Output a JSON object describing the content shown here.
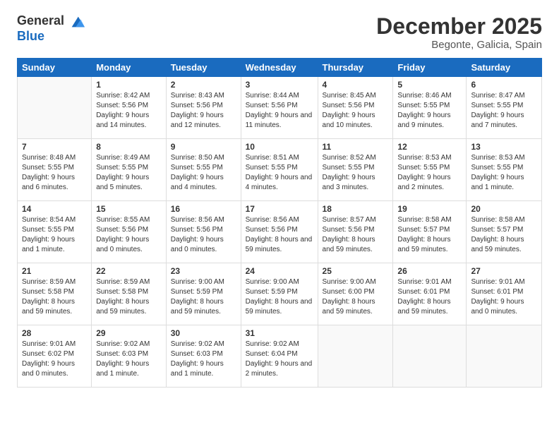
{
  "logo": {
    "general": "General",
    "blue": "Blue"
  },
  "title": "December 2025",
  "location": "Begonte, Galicia, Spain",
  "days_of_week": [
    "Sunday",
    "Monday",
    "Tuesday",
    "Wednesday",
    "Thursday",
    "Friday",
    "Saturday"
  ],
  "weeks": [
    [
      {
        "day": "",
        "sunrise": "",
        "sunset": "",
        "daylight": ""
      },
      {
        "day": "1",
        "sunrise": "Sunrise: 8:42 AM",
        "sunset": "Sunset: 5:56 PM",
        "daylight": "Daylight: 9 hours and 14 minutes."
      },
      {
        "day": "2",
        "sunrise": "Sunrise: 8:43 AM",
        "sunset": "Sunset: 5:56 PM",
        "daylight": "Daylight: 9 hours and 12 minutes."
      },
      {
        "day": "3",
        "sunrise": "Sunrise: 8:44 AM",
        "sunset": "Sunset: 5:56 PM",
        "daylight": "Daylight: 9 hours and 11 minutes."
      },
      {
        "day": "4",
        "sunrise": "Sunrise: 8:45 AM",
        "sunset": "Sunset: 5:56 PM",
        "daylight": "Daylight: 9 hours and 10 minutes."
      },
      {
        "day": "5",
        "sunrise": "Sunrise: 8:46 AM",
        "sunset": "Sunset: 5:55 PM",
        "daylight": "Daylight: 9 hours and 9 minutes."
      },
      {
        "day": "6",
        "sunrise": "Sunrise: 8:47 AM",
        "sunset": "Sunset: 5:55 PM",
        "daylight": "Daylight: 9 hours and 7 minutes."
      }
    ],
    [
      {
        "day": "7",
        "sunrise": "Sunrise: 8:48 AM",
        "sunset": "Sunset: 5:55 PM",
        "daylight": "Daylight: 9 hours and 6 minutes."
      },
      {
        "day": "8",
        "sunrise": "Sunrise: 8:49 AM",
        "sunset": "Sunset: 5:55 PM",
        "daylight": "Daylight: 9 hours and 5 minutes."
      },
      {
        "day": "9",
        "sunrise": "Sunrise: 8:50 AM",
        "sunset": "Sunset: 5:55 PM",
        "daylight": "Daylight: 9 hours and 4 minutes."
      },
      {
        "day": "10",
        "sunrise": "Sunrise: 8:51 AM",
        "sunset": "Sunset: 5:55 PM",
        "daylight": "Daylight: 9 hours and 4 minutes."
      },
      {
        "day": "11",
        "sunrise": "Sunrise: 8:52 AM",
        "sunset": "Sunset: 5:55 PM",
        "daylight": "Daylight: 9 hours and 3 minutes."
      },
      {
        "day": "12",
        "sunrise": "Sunrise: 8:53 AM",
        "sunset": "Sunset: 5:55 PM",
        "daylight": "Daylight: 9 hours and 2 minutes."
      },
      {
        "day": "13",
        "sunrise": "Sunrise: 8:53 AM",
        "sunset": "Sunset: 5:55 PM",
        "daylight": "Daylight: 9 hours and 1 minute."
      }
    ],
    [
      {
        "day": "14",
        "sunrise": "Sunrise: 8:54 AM",
        "sunset": "Sunset: 5:55 PM",
        "daylight": "Daylight: 9 hours and 1 minute."
      },
      {
        "day": "15",
        "sunrise": "Sunrise: 8:55 AM",
        "sunset": "Sunset: 5:56 PM",
        "daylight": "Daylight: 9 hours and 0 minutes."
      },
      {
        "day": "16",
        "sunrise": "Sunrise: 8:56 AM",
        "sunset": "Sunset: 5:56 PM",
        "daylight": "Daylight: 9 hours and 0 minutes."
      },
      {
        "day": "17",
        "sunrise": "Sunrise: 8:56 AM",
        "sunset": "Sunset: 5:56 PM",
        "daylight": "Daylight: 8 hours and 59 minutes."
      },
      {
        "day": "18",
        "sunrise": "Sunrise: 8:57 AM",
        "sunset": "Sunset: 5:56 PM",
        "daylight": "Daylight: 8 hours and 59 minutes."
      },
      {
        "day": "19",
        "sunrise": "Sunrise: 8:58 AM",
        "sunset": "Sunset: 5:57 PM",
        "daylight": "Daylight: 8 hours and 59 minutes."
      },
      {
        "day": "20",
        "sunrise": "Sunrise: 8:58 AM",
        "sunset": "Sunset: 5:57 PM",
        "daylight": "Daylight: 8 hours and 59 minutes."
      }
    ],
    [
      {
        "day": "21",
        "sunrise": "Sunrise: 8:59 AM",
        "sunset": "Sunset: 5:58 PM",
        "daylight": "Daylight: 8 hours and 59 minutes."
      },
      {
        "day": "22",
        "sunrise": "Sunrise: 8:59 AM",
        "sunset": "Sunset: 5:58 PM",
        "daylight": "Daylight: 8 hours and 59 minutes."
      },
      {
        "day": "23",
        "sunrise": "Sunrise: 9:00 AM",
        "sunset": "Sunset: 5:59 PM",
        "daylight": "Daylight: 8 hours and 59 minutes."
      },
      {
        "day": "24",
        "sunrise": "Sunrise: 9:00 AM",
        "sunset": "Sunset: 5:59 PM",
        "daylight": "Daylight: 8 hours and 59 minutes."
      },
      {
        "day": "25",
        "sunrise": "Sunrise: 9:00 AM",
        "sunset": "Sunset: 6:00 PM",
        "daylight": "Daylight: 8 hours and 59 minutes."
      },
      {
        "day": "26",
        "sunrise": "Sunrise: 9:01 AM",
        "sunset": "Sunset: 6:01 PM",
        "daylight": "Daylight: 8 hours and 59 minutes."
      },
      {
        "day": "27",
        "sunrise": "Sunrise: 9:01 AM",
        "sunset": "Sunset: 6:01 PM",
        "daylight": "Daylight: 9 hours and 0 minutes."
      }
    ],
    [
      {
        "day": "28",
        "sunrise": "Sunrise: 9:01 AM",
        "sunset": "Sunset: 6:02 PM",
        "daylight": "Daylight: 9 hours and 0 minutes."
      },
      {
        "day": "29",
        "sunrise": "Sunrise: 9:02 AM",
        "sunset": "Sunset: 6:03 PM",
        "daylight": "Daylight: 9 hours and 1 minute."
      },
      {
        "day": "30",
        "sunrise": "Sunrise: 9:02 AM",
        "sunset": "Sunset: 6:03 PM",
        "daylight": "Daylight: 9 hours and 1 minute."
      },
      {
        "day": "31",
        "sunrise": "Sunrise: 9:02 AM",
        "sunset": "Sunset: 6:04 PM",
        "daylight": "Daylight: 9 hours and 2 minutes."
      },
      {
        "day": "",
        "sunrise": "",
        "sunset": "",
        "daylight": ""
      },
      {
        "day": "",
        "sunrise": "",
        "sunset": "",
        "daylight": ""
      },
      {
        "day": "",
        "sunrise": "",
        "sunset": "",
        "daylight": ""
      }
    ]
  ]
}
